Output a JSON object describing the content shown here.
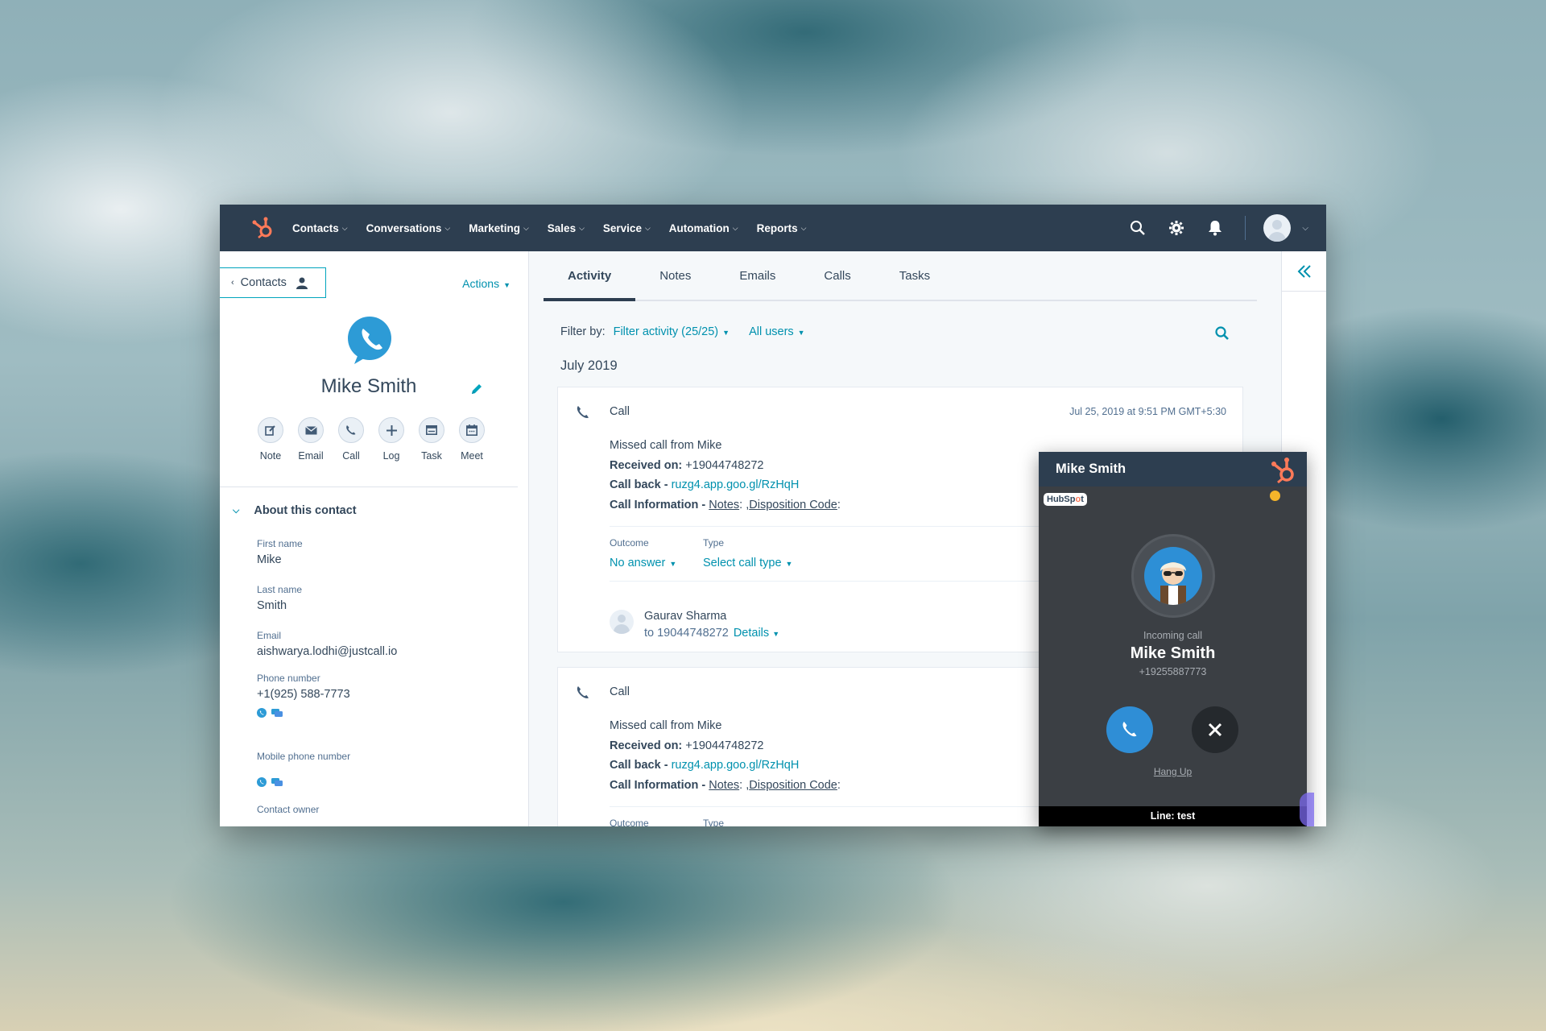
{
  "topnav": {
    "items": [
      "Contacts",
      "Conversations",
      "Marketing",
      "Sales",
      "Service",
      "Automation",
      "Reports"
    ]
  },
  "sidebar": {
    "back_label": "Contacts",
    "actions_label": "Actions",
    "contact_name": "Mike Smith",
    "quick_actions": [
      "Note",
      "Email",
      "Call",
      "Log",
      "Task",
      "Meet"
    ],
    "about_title": "About this contact",
    "properties": {
      "first_name_label": "First name",
      "first_name": "Mike",
      "last_name_label": "Last name",
      "last_name": "Smith",
      "email_label": "Email",
      "email": "aishwarya.lodhi@justcall.io",
      "phone_label": "Phone number",
      "phone": "+1(925) 588-7773",
      "mobile_label": "Mobile phone number",
      "owner_label": "Contact owner"
    }
  },
  "main": {
    "tabs": [
      "Activity",
      "Notes",
      "Emails",
      "Calls",
      "Tasks"
    ],
    "active_tab": "Activity",
    "filter_label": "Filter by:",
    "filter_activity": "Filter activity (25/25)",
    "all_users": "All users",
    "month": "July 2019",
    "cards": [
      {
        "type": "Call",
        "date": "Jul 25, 2019 at 9:51 PM GMT+5:30",
        "missed": "Missed call from Mike",
        "received_label": "Received on:",
        "received_value": "+19044748272",
        "callback_label": "Call back -",
        "callback_value": "ruzg4.app.goo.gl/RzHqH",
        "info_label": "Call Information -",
        "info_notes": "Notes",
        "info_sep": ": ,",
        "info_disposition": "Disposition Code",
        "info_end": ":",
        "outcome_label": "Outcome",
        "outcome_value": "No answer",
        "type_label": "Type",
        "type_value": "Select call type",
        "user_name": "Gaurav Sharma",
        "user_to": "to 19044748272",
        "details": "Details"
      },
      {
        "type": "Call",
        "missed": "Missed call from Mike",
        "received_label": "Received on:",
        "received_value": "+19044748272",
        "callback_label": "Call back -",
        "callback_value": "ruzg4.app.goo.gl/RzHqH",
        "info_label": "Call Information -",
        "info_notes": "Notes",
        "info_sep": ": ,",
        "info_disposition": "Disposition Code",
        "info_end": ":",
        "outcome_label": "Outcome",
        "type_label": "Type"
      }
    ]
  },
  "dialer": {
    "header_name": "Mike Smith",
    "badge_prefix": "HubSp",
    "badge_o": "o",
    "badge_suffix": "t",
    "incoming": "Incoming call",
    "caller_name": "Mike Smith",
    "caller_number": "+19255887773",
    "hangup": "Hang Up",
    "line": "Line: test"
  },
  "colors": {
    "nav_bg": "#2d3e50",
    "accent": "#0091ae",
    "hubspot_orange": "#ff7a59",
    "dialer_bg": "#3b3f44",
    "answer_blue": "#2f8ed6",
    "status_yellow": "#f5b52a"
  }
}
